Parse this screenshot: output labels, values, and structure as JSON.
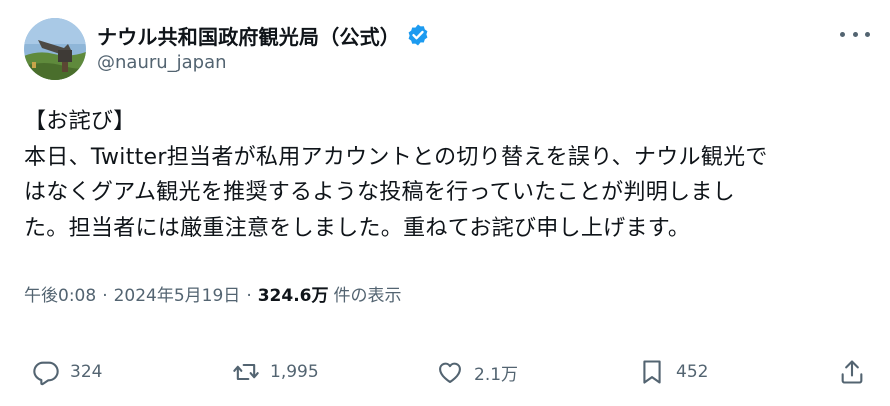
{
  "author": {
    "display_name": "ナウル共和国政府観光局（公式）",
    "handle": "@nauru_japan",
    "verified_color": "#1d9bf0"
  },
  "tweet": {
    "lines": [
      "【お詫び】",
      "本日、Twitter担当者が私用アカウントとの切り替えを誤り、ナウル観光で",
      "はなくグアム観光を推奨するような投稿を行っていたことが判明しまし",
      "た。担当者には厳重注意をしました。重ねてお詫び申し上げます。"
    ]
  },
  "meta": {
    "time": "午後0:08",
    "separator": "·",
    "date": "2024年5月19日",
    "views_count": "324.6万",
    "views_label": "件の表示"
  },
  "actions": {
    "reply_count": "324",
    "retweet_count": "1,995",
    "like_count": "2.1万",
    "bookmark_count": "452"
  },
  "icons": {
    "avatar": "nauru-landscape-avatar",
    "verified": "verified-badge-icon",
    "more": "more-options-icon",
    "reply": "reply-icon",
    "retweet": "retweet-icon",
    "like": "heart-icon",
    "bookmark": "bookmark-icon",
    "share": "share-icon"
  }
}
